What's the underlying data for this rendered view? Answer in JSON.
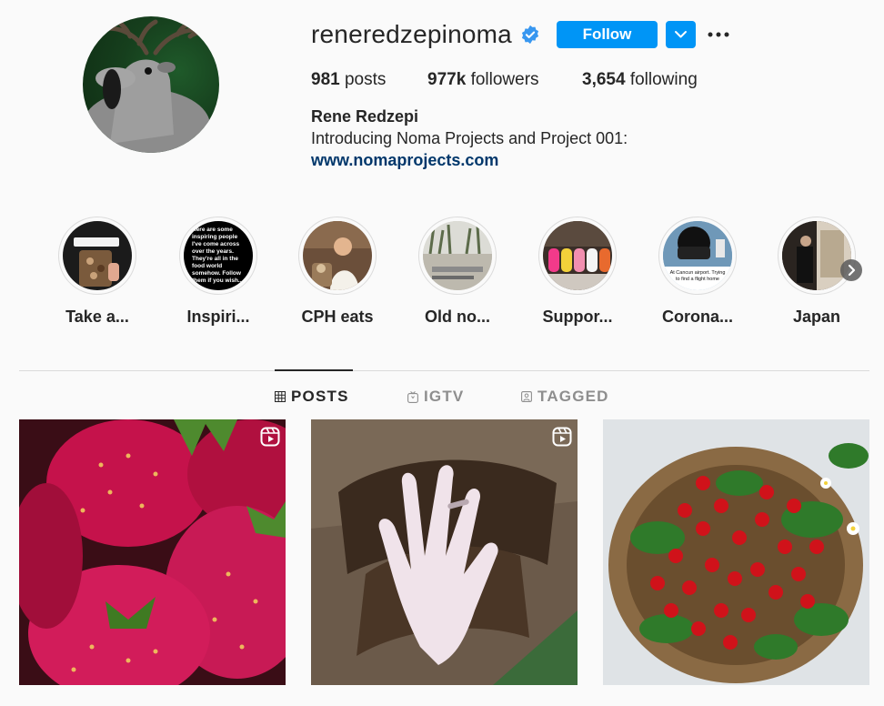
{
  "profile": {
    "username": "reneredzepinoma",
    "verified": true,
    "follow_label": "Follow",
    "dropdown_icon": "chevron-down-icon",
    "more_icon": "more-options-icon",
    "accent_color": "#0095f6",
    "stats": {
      "posts_count": "981",
      "posts_label": "posts",
      "followers_count": "977k",
      "followers_label": "followers",
      "following_count": "3,654",
      "following_label": "following"
    },
    "bio": {
      "name": "Rene Redzepi",
      "text": "Introducing Noma Projects and Project 001:",
      "link": "www.nomaprojects.com"
    }
  },
  "highlights": [
    {
      "label": "Take a..."
    },
    {
      "label": "Inspiri..."
    },
    {
      "label": "CPH eats"
    },
    {
      "label": "Old no..."
    },
    {
      "label": "Suppor..."
    },
    {
      "label": "Corona..."
    },
    {
      "label": "Japan"
    }
  ],
  "highlight_texts": {
    "inspiring": "Here are some inspiring people I've come across over the years. They're all in the food world somehow. Follow them if you wish...",
    "corona": "At Cancun airport. Trying to find a flight home"
  },
  "tabs": [
    {
      "label": "POSTS",
      "icon": "grid-icon",
      "active": true
    },
    {
      "label": "IGTV",
      "icon": "igtv-icon",
      "active": false
    },
    {
      "label": "TAGGED",
      "icon": "tagged-icon",
      "active": false
    }
  ],
  "posts": [
    {
      "subject": "strawberries",
      "reel": true
    },
    {
      "subject": "hand on fur",
      "reel": true
    },
    {
      "subject": "wild strawberries in basket",
      "reel": false
    }
  ]
}
